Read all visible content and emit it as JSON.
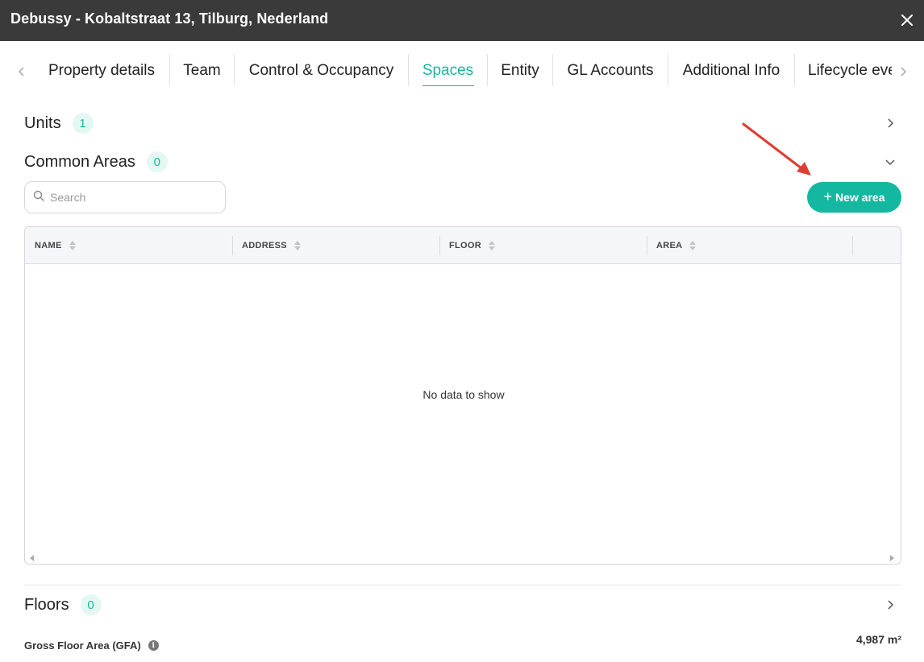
{
  "window": {
    "title": "Debussy - Kobaltstraat 13, Tilburg, Nederland"
  },
  "tabs": [
    {
      "label": "Property details"
    },
    {
      "label": "Team"
    },
    {
      "label": "Control & Occupancy"
    },
    {
      "label": "Spaces",
      "active": true
    },
    {
      "label": "Entity"
    },
    {
      "label": "GL Accounts"
    },
    {
      "label": "Additional Info"
    },
    {
      "label": "Lifecycle events"
    }
  ],
  "sections": {
    "units": {
      "title": "Units",
      "count": "1"
    },
    "common_areas": {
      "title": "Common Areas",
      "count": "0"
    },
    "floors": {
      "title": "Floors",
      "count": "0"
    }
  },
  "search": {
    "placeholder": "Search"
  },
  "new_area_button": {
    "label": "New area"
  },
  "table": {
    "columns": [
      "NAME",
      "ADDRESS",
      "FLOOR",
      "AREA"
    ],
    "empty_message": "No data to show"
  },
  "gfa": {
    "label": "Gross Floor Area (GFA)",
    "value": "4,987 m²"
  },
  "colors": {
    "accent": "#14b8a0",
    "titlebar": "#3a3a3a",
    "annotation_arrow": "#e03c31"
  },
  "icons": [
    "close-icon",
    "chevron-left-icon",
    "chevron-right-icon",
    "chevron-down-icon",
    "search-icon",
    "plus-icon",
    "sort-icon",
    "info-icon"
  ]
}
